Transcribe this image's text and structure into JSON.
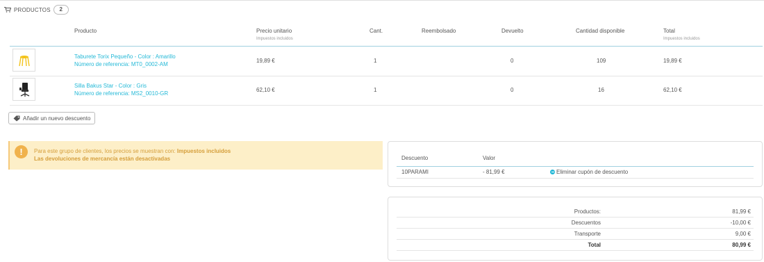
{
  "header": {
    "title": "PRODUCTOS",
    "count": "2"
  },
  "table": {
    "columns": {
      "product": "Producto",
      "unit_price": "Precio unitario",
      "unit_price_sub": "Impuestos incluidos",
      "qty": "Cant.",
      "refunded": "Reembolsado",
      "returned": "Devuelto",
      "available": "Cantidad disponible",
      "total": "Total",
      "total_sub": "Impuestos incluidos"
    },
    "rows": [
      {
        "name": "Taburete Torix Pequeño - Color : Amarillo",
        "ref": "Número de referencia: MT0_0002-AM",
        "unit_price": "19,89 €",
        "qty": "1",
        "refunded": "",
        "returned": "0",
        "available": "109",
        "total": "19,89 €",
        "image_icon": "stool-icon"
      },
      {
        "name": "Silla Bakus Star - Color : Gris",
        "ref": "Número de referencia: MS2_0010-GR",
        "unit_price": "62,10 €",
        "qty": "1",
        "refunded": "",
        "returned": "0",
        "available": "16",
        "total": "62,10 €",
        "image_icon": "office-chair-icon"
      }
    ]
  },
  "add_discount": {
    "label": "Añadir un nuevo descuento"
  },
  "alert": {
    "line1_prefix": "Para este grupo de clientes, los precios se muestran con:",
    "line1_bold": "Impuestos incluidos",
    "line2": "Las devoluciones de mercancía están desactivadas"
  },
  "discounts": {
    "col_discount": "Descuento",
    "col_value": "Valor",
    "rows": [
      {
        "code": "10PARAMI",
        "value": "- 81,99 €",
        "remove_label": "Eliminar cupón de descuento"
      }
    ]
  },
  "totals": [
    {
      "label": "Productos:",
      "value": "81,99 €"
    },
    {
      "label": "Descuentos",
      "value": "-10,00 €"
    },
    {
      "label": "Transporte",
      "value": "9,00 €"
    },
    {
      "label": "Total",
      "value": "80,99 €"
    }
  ],
  "colors": {
    "accent": "#25b9d7",
    "warning_bg": "#fdefc8",
    "warning_text": "#d59e3a",
    "stool": "#f3c31b"
  }
}
